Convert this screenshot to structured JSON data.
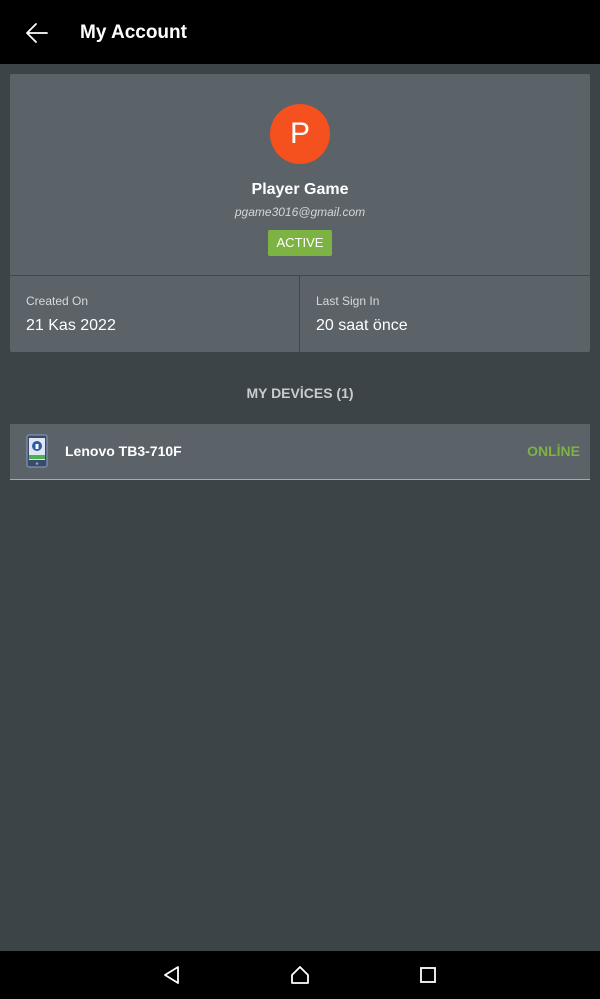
{
  "appbar": {
    "title": "My Account",
    "back_icon": "arrow-left-icon"
  },
  "profile": {
    "avatar_letter": "P",
    "avatar_color": "#f4511e",
    "name": "Player Game",
    "email": "pgame3016@gmail.com",
    "status": "ACTIVE",
    "status_color": "#7cb342",
    "created_label": "Created On",
    "created_value": "21 Kas 2022",
    "last_sign_label": "Last Sign In",
    "last_sign_value": "20 saat önce"
  },
  "devices": {
    "section_title": "MY DEVİCES (1)",
    "items": [
      {
        "icon": "device-lock-icon",
        "name": "Lenovo TB3-710F",
        "status": "ONLİNE",
        "status_color": "#7cb342"
      }
    ]
  },
  "navbar": {
    "back": "nav-back-icon",
    "home": "nav-home-icon",
    "recents": "nav-recents-icon"
  }
}
